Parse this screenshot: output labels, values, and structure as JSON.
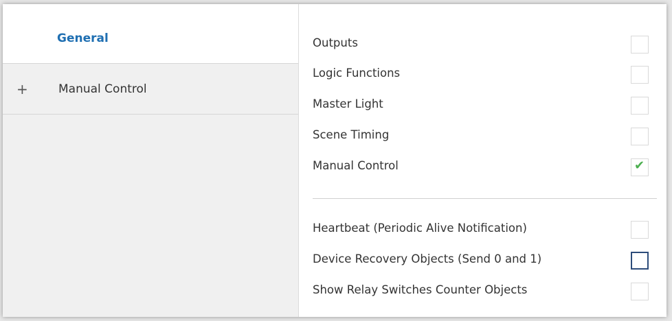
{
  "sidebar": {
    "items": [
      {
        "label": "General",
        "selected": true
      },
      {
        "label": "Manual Control",
        "expand_icon": "+"
      }
    ]
  },
  "general": {
    "options": [
      {
        "label": "Outputs",
        "checked": false
      },
      {
        "label": "Logic Functions",
        "checked": false
      },
      {
        "label": "Master Light",
        "checked": false
      },
      {
        "label": "Scene Timing",
        "checked": false
      },
      {
        "label": "Manual Control",
        "checked": true
      }
    ],
    "extra_options": [
      {
        "label": "Heartbeat (Periodic Alive Notification)",
        "checked": false
      },
      {
        "label": "Device Recovery Objects (Send 0 and 1)",
        "checked": false,
        "focused": true
      },
      {
        "label": "Show Relay Switches Counter Objects",
        "checked": false
      }
    ]
  },
  "colors": {
    "accent": "#1f6fb2",
    "check": "#4caf50",
    "focus_border": "#2d4c7a",
    "sidebar_bg": "#f0f0f0"
  },
  "icons": {
    "expand": "plus-icon",
    "checkmark": "checkmark-icon"
  }
}
